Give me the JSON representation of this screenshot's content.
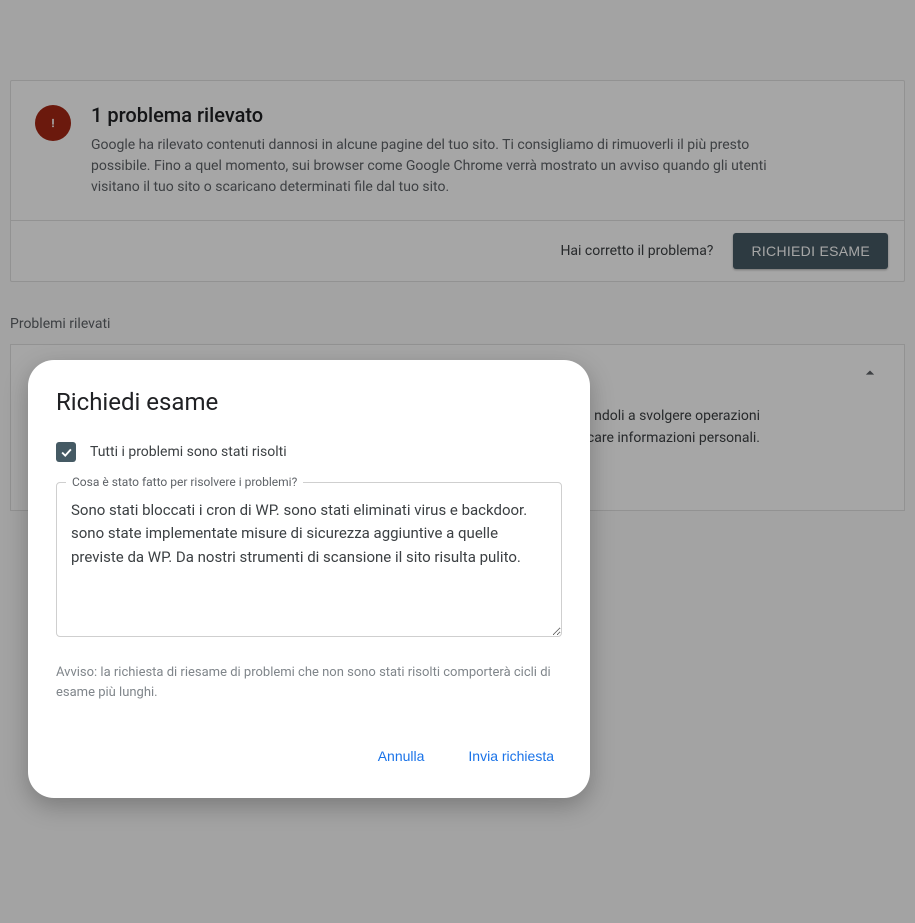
{
  "alert": {
    "title": "1 problema rilevato",
    "description": "Google ha rilevato contenuti dannosi in alcune pagine del tuo sito. Ti consigliamo di rimuoverli il più presto possibile. Fino a quel momento, sui browser come Google Chrome verrà mostrato un avviso quando gli utenti visitano il tuo sito o scaricano determinati file dal tuo sito.",
    "footer_question": "Hai corretto il problema?",
    "request_button": "RICHIEDI ESAME"
  },
  "section": {
    "label": "Problemi rilevati",
    "body_line1": "ndoli a svolgere operazioni",
    "body_line2": "ndicare informazioni personali."
  },
  "modal": {
    "title": "Richiedi esame",
    "checkbox_label": "Tutti i problemi sono stati risolti",
    "textarea_label": "Cosa è stato fatto per risolvere i problemi?",
    "textarea_value": "Sono stati bloccati i cron di WP. sono stati eliminati virus e backdoor. sono state implementate misure di sicurezza aggiuntive a quelle previste da WP. Da nostri strumenti di scansione il sito risulta pulito.",
    "notice": "Avviso: la richiesta di riesame di problemi che non sono stati risolti comporterà cicli di esame più lunghi.",
    "cancel": "Annulla",
    "submit": "Invia richiesta"
  }
}
